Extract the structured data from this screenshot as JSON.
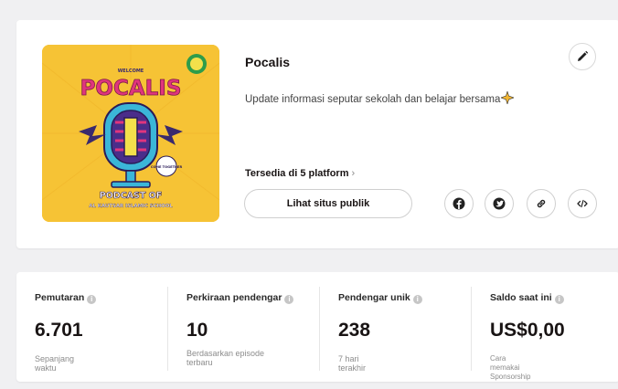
{
  "show": {
    "title": "Pocalis",
    "description": "Update informasi seputar sekolah dan belajar bersama",
    "platforms_label": "Tersedia di 5 platform",
    "public_site_label": "Lihat situs publik",
    "cover": {
      "welcome": "WELCOME",
      "name": "POCALIS",
      "badge": "COME TOGETHER",
      "line1": "PODCAST OF",
      "line2": "AL KAUTSAR ISLAMIC SCHOOL"
    }
  },
  "icons": {
    "edit": "pencil-icon",
    "facebook": "facebook-icon",
    "twitter": "twitter-icon",
    "link": "link-icon",
    "embed": "code-icon",
    "info": "info-icon",
    "sparkle": "sparkle-icon"
  },
  "stats": [
    {
      "label": "Pemutaran",
      "value": "6.701",
      "sub": "Sepanjang waktu"
    },
    {
      "label": "Perkiraan pendengar",
      "value": "10",
      "sub": "Berdasarkan episode terbaru"
    },
    {
      "label": "Pendengar unik",
      "value": "238",
      "sub": "7 hari terakhir"
    },
    {
      "label": "Saldo saat ini",
      "value": "US$0,00",
      "sub": "Cara memakai Sponsorship"
    }
  ],
  "colors": {
    "cover_bg": "#f6c335",
    "cover_title": "#e0357d",
    "cover_mic": "#4a2d8a",
    "cover_mic_accent": "#3bb6d8"
  }
}
